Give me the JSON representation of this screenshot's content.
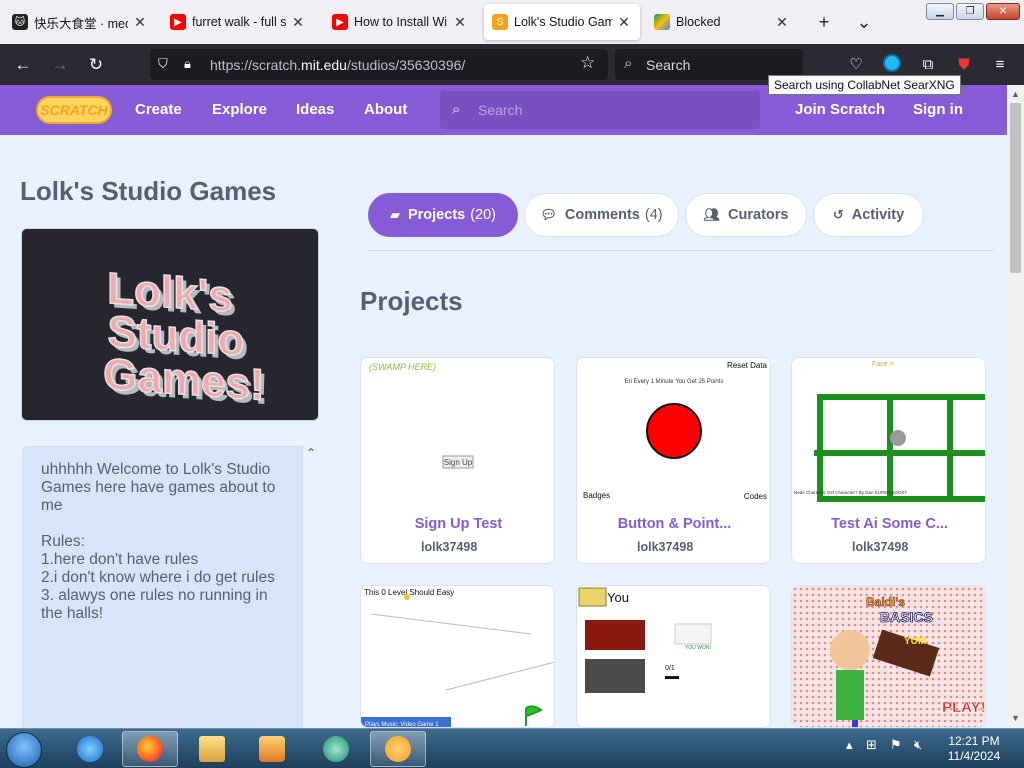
{
  "browser": {
    "tabs": [
      {
        "title": "快乐大食堂 · meow",
        "favicon": "cat-icon",
        "active": false
      },
      {
        "title": "furret walk - full song",
        "favicon": "youtube-icon",
        "active": false
      },
      {
        "title": "How to Install Windows",
        "favicon": "youtube-icon",
        "active": false
      },
      {
        "title": "Lolk's Studio Games",
        "favicon": "scratch-icon",
        "active": true
      },
      {
        "title": "Blocked",
        "favicon": "drive-icon",
        "active": false
      }
    ],
    "new_tab_glyph": "+",
    "list_tabs_glyph": "⌄",
    "url_prefix": "https://scratch.",
    "url_host": "mit.edu",
    "url_path": "/studios/35630396/",
    "search_label": "Search",
    "search_tooltip": "Search using CollabNet SearXNG",
    "extension_badge": "1",
    "accent": "#2b2a33"
  },
  "scratch_header": {
    "logo_text": "SCRATCH",
    "nav": [
      "Create",
      "Explore",
      "Ideas",
      "About"
    ],
    "search_placeholder": "Search",
    "join_label": "Join Scratch",
    "signin_label": "Sign in",
    "brand_color": "#855cd6"
  },
  "studio": {
    "title": "Lolk's Studio Games",
    "thumbnail_text": [
      "Lolk's",
      "Studio",
      "Games!"
    ],
    "description": "uhhhhh Welcome to Lolk's Studio Games here have games about to me\n\nRules:\n1.here don't have rules\n2.i don't know where i do get rules\n3. alawys one rules no running in the halls!"
  },
  "tabs": [
    {
      "label": "Projects",
      "count": "(20)",
      "icon": "projects-icon",
      "active": true
    },
    {
      "label": "Comments",
      "count": "(4)",
      "icon": "comment-icon",
      "active": false
    },
    {
      "label": "Curators",
      "count": "",
      "icon": "curators-icon",
      "active": false
    },
    {
      "label": "Activity",
      "count": "",
      "icon": "activity-icon",
      "active": false
    }
  ],
  "section_title": "Projects",
  "projects": [
    {
      "title": "Sign Up Test",
      "author": "lolk37498",
      "thumb_texts": [
        "(SWAMP HERE)",
        "Sign Up"
      ]
    },
    {
      "title": "Button & Point...",
      "author": "lolk37498",
      "thumb_texts": [
        "Reset Data",
        "Eri Every 1 Minute You Get 25 Points",
        "Badges",
        "Codes"
      ]
    },
    {
      "title": "Test Ai Some C...",
      "author": "lolk37498",
      "thumb_texts": [
        "Face >",
        "Node Character Girl Character? By Dan SUPER BOOST"
      ]
    },
    {
      "title": "",
      "author": "",
      "thumb_texts": [
        "This 0 Level Should Easy",
        "Plays Music: Video Game 1"
      ]
    },
    {
      "title": "",
      "author": "",
      "thumb_texts": [
        "You",
        "YOU WON!",
        "0/1"
      ]
    },
    {
      "title": "",
      "author": "",
      "thumb_texts": [
        "Baldi's",
        "BASICS",
        "YUM",
        "PLAY!"
      ]
    }
  ],
  "taskbar": {
    "time": "12:21 PM",
    "date": "11/4/2024"
  }
}
